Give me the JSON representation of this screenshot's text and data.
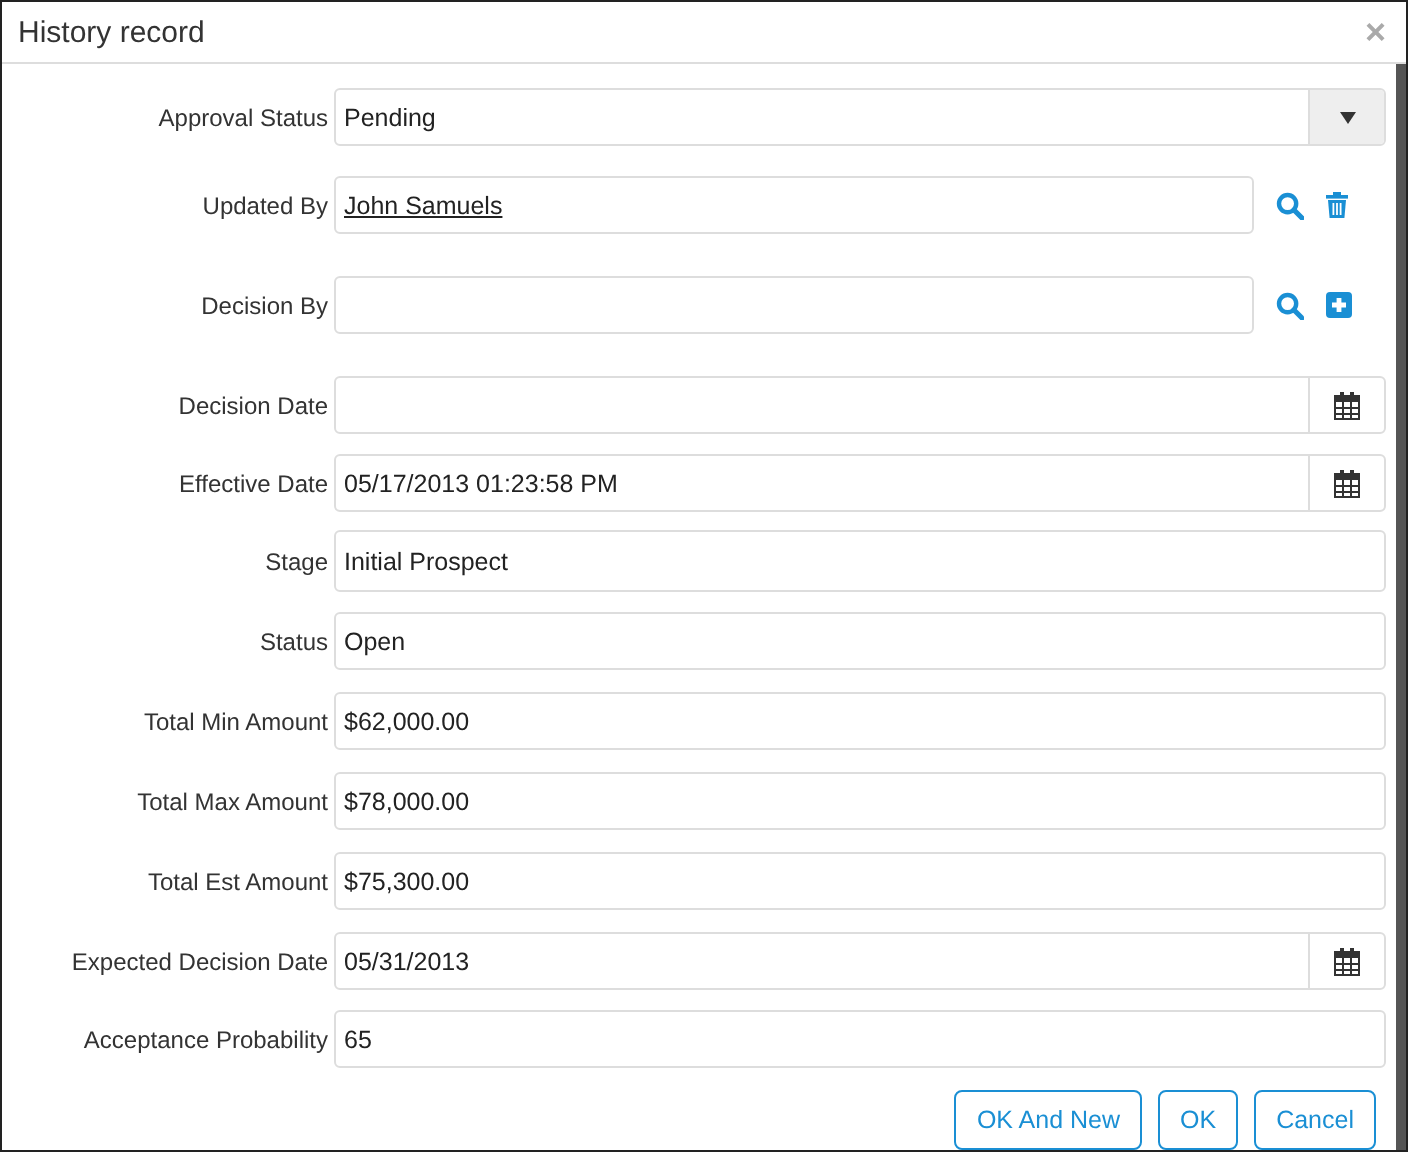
{
  "window": {
    "title": "History record",
    "close": "×"
  },
  "fields": [
    {
      "label": "Approval Status",
      "kind": "select",
      "value": "Pending"
    },
    {
      "label": "Updated By",
      "kind": "lookup",
      "value": "John Samuels",
      "actions": [
        {
          "kind": "search"
        },
        {
          "kind": "delete"
        }
      ]
    },
    {
      "label": "Decision By",
      "kind": "lookup",
      "actions": [
        {
          "kind": "search"
        },
        {
          "kind": "add"
        }
      ]
    },
    {
      "label": "Decision Date",
      "kind": "date"
    },
    {
      "label": "Effective Date",
      "kind": "date",
      "value": "05/17/2013 01:23:58 PM"
    },
    {
      "label": "Stage",
      "kind": "text",
      "value": "Initial Prospect"
    },
    {
      "label": "Status",
      "kind": "text",
      "value": "Open"
    },
    {
      "label": "Total Min Amount",
      "kind": "text",
      "value": "$62,000.00"
    },
    {
      "label": "Total Max Amount",
      "kind": "text",
      "value": "$78,000.00"
    },
    {
      "label": "Total Est Amount",
      "kind": "text",
      "value": "$75,300.00"
    },
    {
      "label": "Expected Decision Date",
      "kind": "date",
      "value": "05/31/2013"
    },
    {
      "label": "Acceptance Probability",
      "kind": "text",
      "value": "65"
    }
  ],
  "buttons": [
    "OK And New",
    "OK",
    "Cancel"
  ]
}
